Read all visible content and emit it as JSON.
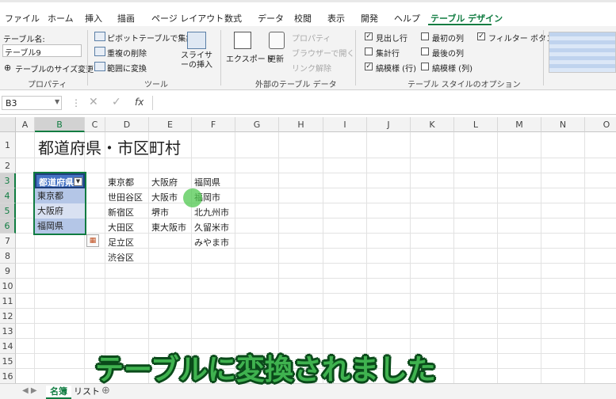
{
  "tabs": [
    "ファイル",
    "ホーム",
    "挿入",
    "描画",
    "ページ レイアウト",
    "数式",
    "データ",
    "校閲",
    "表示",
    "開発",
    "ヘルプ",
    "テーブル デザイン"
  ],
  "ribbon": {
    "props": {
      "table_name_label": "テーブル名:",
      "table_name_value": "テーブル9",
      "resize_label": "テーブルのサイズ変更",
      "group": "プロパティ"
    },
    "tools": {
      "pivot": "ピボットテーブルで集計",
      "dedupe": "重複の削除",
      "convert": "範囲に変換",
      "slicer": "スライサーの挿入",
      "group": "ツール"
    },
    "external": {
      "export": "エクスポート",
      "refresh": "更新",
      "properties": "プロパティ",
      "browser": "ブラウザーで開く",
      "unlink": "リンク解除",
      "group": "外部のテーブル データ"
    },
    "options": {
      "header_row": "見出し行",
      "total_row": "集計行",
      "banded_rows": "縞模様 (行)",
      "first_col": "最初の列",
      "last_col": "最後の列",
      "banded_cols": "縞模様 (列)",
      "filter_btn": "フィルター ボタン",
      "group": "テーブル スタイルのオプション"
    }
  },
  "formula_bar": {
    "name_box": "B3",
    "fx": "fx"
  },
  "columns": [
    "A",
    "B",
    "C",
    "D",
    "E",
    "F",
    "G",
    "H",
    "I",
    "J",
    "K",
    "L",
    "M",
    "N",
    "O"
  ],
  "rows": [
    "1",
    "2",
    "3",
    "4",
    "5",
    "6",
    "7",
    "8",
    "9",
    "10",
    "11",
    "12",
    "13",
    "14",
    "15",
    "16",
    "17"
  ],
  "sheet": {
    "title": "都道府県・市区町村",
    "table_header": "都道府県",
    "table_rows": [
      "東京都",
      "大阪府",
      "福岡県"
    ],
    "col_d": [
      "東京都",
      "世田谷区",
      "新宿区",
      "大田区",
      "足立区",
      "渋谷区"
    ],
    "col_e": [
      "大阪府",
      "大阪市",
      "堺市",
      "東大阪市"
    ],
    "col_f": [
      "福岡県",
      "福岡市",
      "北九州市",
      "久留米市",
      "みやま市"
    ]
  },
  "sheet_tabs": [
    "名簿",
    "リスト"
  ],
  "subtitle": "テーブルに変換されました",
  "colors": {
    "accent": "#107c41",
    "table_header": "#4472c4",
    "band1": "#b4c6e7",
    "band2": "#d9e1f2"
  },
  "icons": [
    "dropdown-arrow-icon",
    "cancel-icon",
    "confirm-icon",
    "function-icon",
    "quick-analysis-icon"
  ]
}
